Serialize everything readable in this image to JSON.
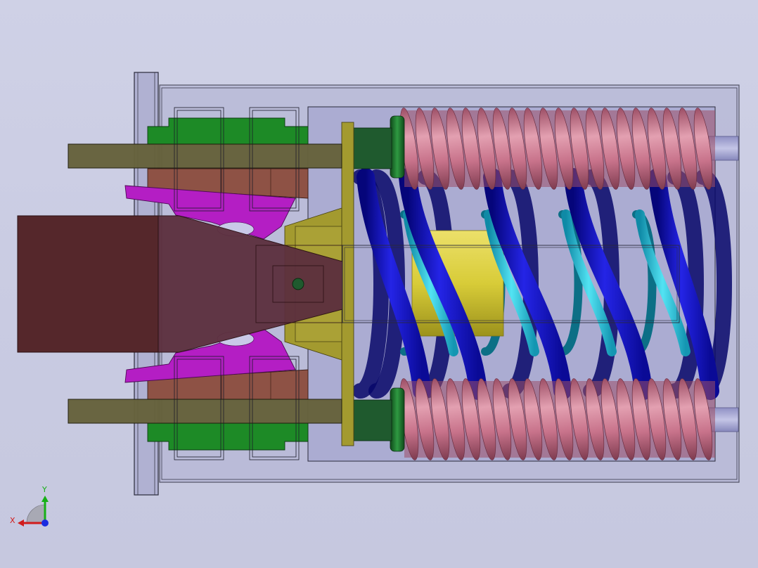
{
  "viewport": {
    "background_top": "#cfd1e6",
    "background_bottom": "#c6c8df"
  },
  "triad": {
    "x_label": "X",
    "y_label": "Y",
    "x_color": "#d11c1c",
    "y_color": "#16b016",
    "z_color": "#1a2be0"
  },
  "colors": {
    "housing_outline": "#2a2a3a",
    "housing_fill": "#b2b3d4",
    "spring_pink": "#c8738b",
    "spring_blue": "#1414c8",
    "spring_cyan": "#20c4dc",
    "core_yellow": "#d8cc38",
    "plate_olive": "#a39a2f",
    "arm_magenta": "#b41ec4",
    "block_green": "#1d8a26",
    "pad_brown": "#8e5245",
    "pin_olive": "#66623c",
    "lever_maroon": "#55272b",
    "bolt_green": "#1f5a2e"
  }
}
